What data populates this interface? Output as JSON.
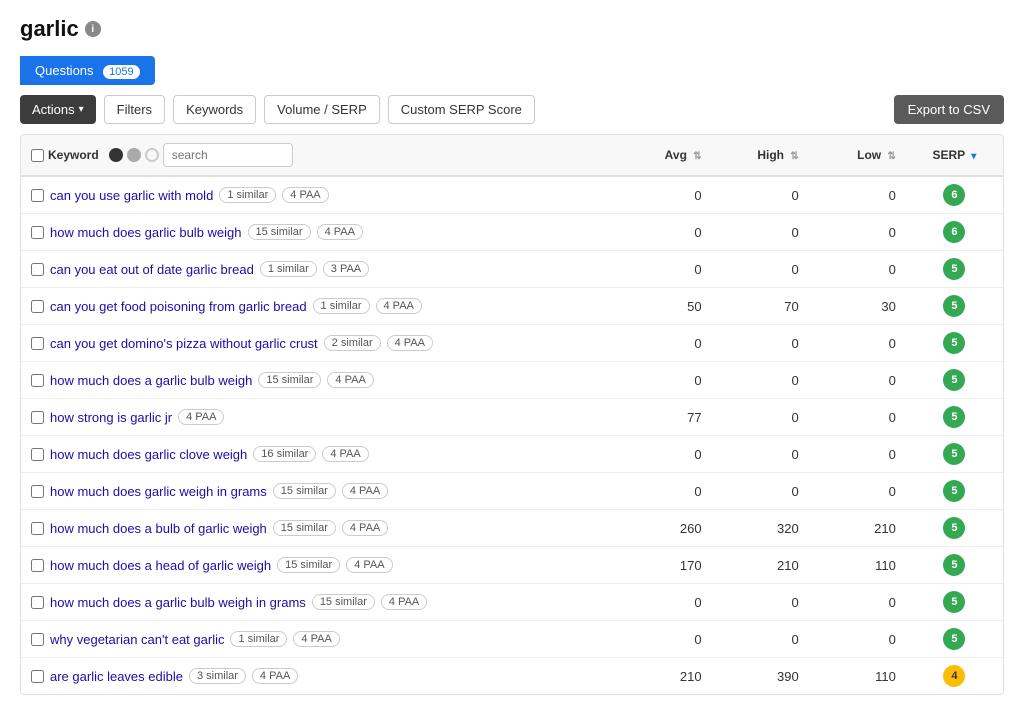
{
  "title": "garlic",
  "tabs": [
    {
      "id": "questions",
      "label": "Questions",
      "badge": "1059",
      "active": true
    }
  ],
  "toolbar": {
    "actions_label": "Actions",
    "filters_label": "Filters",
    "keywords_label": "Keywords",
    "volume_label": "Volume / SERP",
    "custom_label": "Custom SERP Score",
    "export_label": "Export to CSV"
  },
  "table": {
    "columns": [
      {
        "id": "keyword",
        "label": "Keyword"
      },
      {
        "id": "avg",
        "label": "Avg",
        "sortable": true
      },
      {
        "id": "high",
        "label": "High",
        "sortable": true
      },
      {
        "id": "low",
        "label": "Low",
        "sortable": true
      },
      {
        "id": "serp",
        "label": "SERP",
        "sortable": true,
        "sorted": true,
        "dir": "desc"
      }
    ],
    "rows": [
      {
        "keyword": "can you use garlic with mold",
        "tags": [
          "1 similar",
          "4 PAA"
        ],
        "avg": 0,
        "high": 0,
        "low": 0,
        "serp": 6
      },
      {
        "keyword": "how much does garlic bulb weigh",
        "tags": [
          "15 similar",
          "4 PAA"
        ],
        "avg": 0,
        "high": 0,
        "low": 0,
        "serp": 6
      },
      {
        "keyword": "can you eat out of date garlic bread",
        "tags": [
          "1 similar",
          "3 PAA"
        ],
        "avg": 0,
        "high": 0,
        "low": 0,
        "serp": 5
      },
      {
        "keyword": "can you get food poisoning from garlic bread",
        "tags": [
          "1 similar",
          "4 PAA"
        ],
        "avg": 50,
        "high": 70,
        "low": 30,
        "serp": 5
      },
      {
        "keyword": "can you get domino's pizza without garlic crust",
        "tags": [
          "2 similar",
          "4 PAA"
        ],
        "avg": 0,
        "high": 0,
        "low": 0,
        "serp": 5
      },
      {
        "keyword": "how much does a garlic bulb weigh",
        "tags": [
          "15 similar",
          "4 PAA"
        ],
        "avg": 0,
        "high": 0,
        "low": 0,
        "serp": 5
      },
      {
        "keyword": "how strong is garlic jr",
        "tags": [
          "4 PAA"
        ],
        "avg": 77,
        "high": 0,
        "low": 0,
        "serp": 5
      },
      {
        "keyword": "how much does garlic clove weigh",
        "tags": [
          "16 similar",
          "4 PAA"
        ],
        "avg": 0,
        "high": 0,
        "low": 0,
        "serp": 5
      },
      {
        "keyword": "how much does garlic weigh in grams",
        "tags": [
          "15 similar",
          "4 PAA"
        ],
        "avg": 0,
        "high": 0,
        "low": 0,
        "serp": 5
      },
      {
        "keyword": "how much does a bulb of garlic weigh",
        "tags": [
          "15 similar",
          "4 PAA"
        ],
        "avg": 260,
        "high": 320,
        "low": 210,
        "serp": 5
      },
      {
        "keyword": "how much does a head of garlic weigh",
        "tags": [
          "15 similar",
          "4 PAA"
        ],
        "avg": 170,
        "high": 210,
        "low": 110,
        "serp": 5
      },
      {
        "keyword": "how much does a garlic bulb weigh in grams",
        "tags": [
          "15 similar",
          "4 PAA"
        ],
        "avg": 0,
        "high": 0,
        "low": 0,
        "serp": 5
      },
      {
        "keyword": "why vegetarian can't eat garlic",
        "tags": [
          "1 similar",
          "4 PAA"
        ],
        "avg": 0,
        "high": 0,
        "low": 0,
        "serp": 5
      },
      {
        "keyword": "are garlic leaves edible",
        "tags": [
          "3 similar",
          "4 PAA"
        ],
        "avg": 210,
        "high": 390,
        "low": 110,
        "serp": 4
      }
    ]
  },
  "search_placeholder": "search"
}
